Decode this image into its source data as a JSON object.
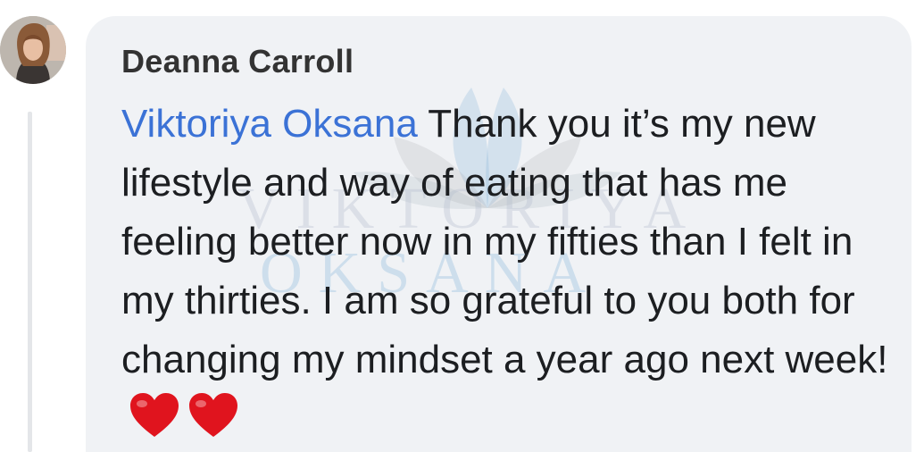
{
  "comment": {
    "author_name": "Deanna Carroll",
    "mention": "Viktoriya Oksana",
    "text": " Thank you it’s my new lifestyle and way of eating that has me feeling better now in my fifties than I felt in my thirties. I am so grateful to you both for changing my mindset a year ago next week!",
    "emojis": [
      "red-heart",
      "red-heart"
    ]
  },
  "watermark": {
    "line1": "VIKTORIYA",
    "line2": "OKSANA"
  },
  "colors": {
    "bubble_background": "#f0f2f5",
    "mention_link": "#3b72d6",
    "author_text": "#333333",
    "body_text": "#1c1e21",
    "heart": "#e0141e"
  }
}
